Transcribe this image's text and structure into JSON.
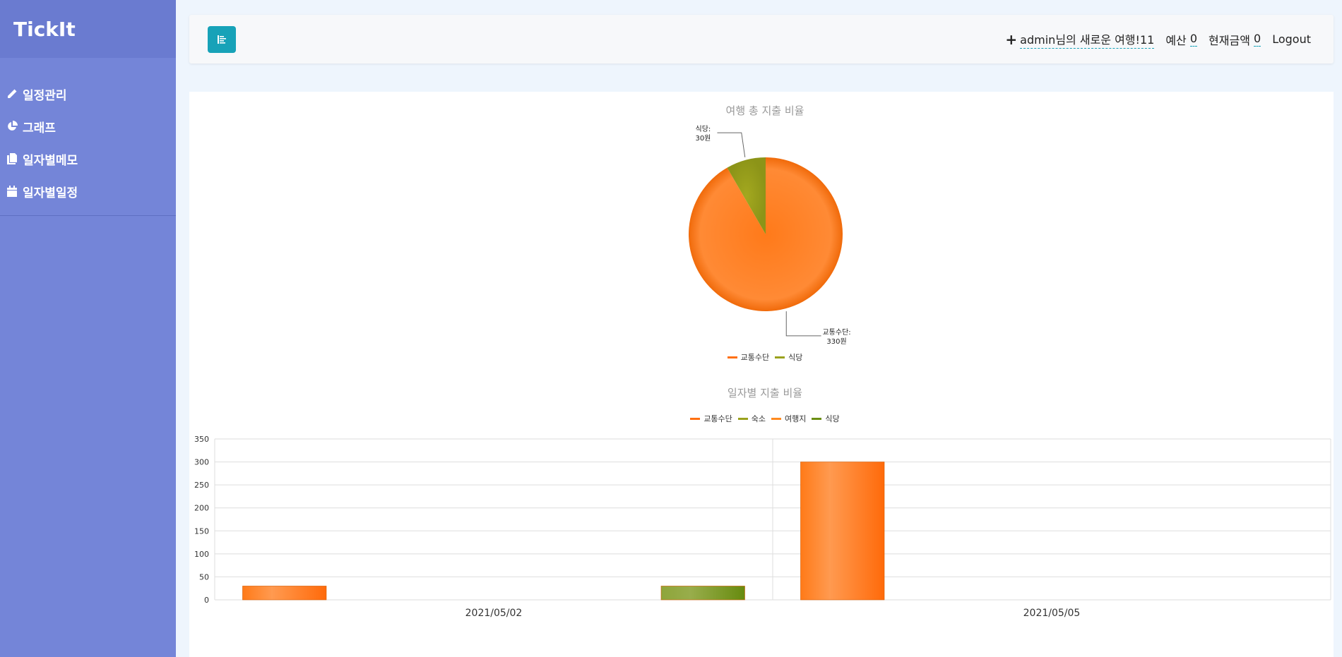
{
  "app": {
    "brand": "TickIt"
  },
  "sidebar": {
    "items": [
      {
        "label": "일정관리",
        "icon": "pencil-icon"
      },
      {
        "label": "그래프",
        "icon": "pie-chart-icon"
      },
      {
        "label": "일자별메모",
        "icon": "copy-icon"
      },
      {
        "label": "일자별일정",
        "icon": "calendar-icon"
      }
    ]
  },
  "topbar": {
    "trip_owner": "admin",
    "trip_suffix": "님의 새로운 여행!11",
    "budget_label": "예산",
    "budget_value": "0",
    "current_label": "현재금액",
    "current_value": "0",
    "logout_label": "Logout"
  },
  "colors": {
    "accent": "#17a2b8",
    "sidebar": "#7485d8",
    "transport": "#ff7011",
    "lodging": "#9aa11c",
    "destination": "#ff8a1f",
    "restaurant": "#6b8e12"
  },
  "chart_data": [
    {
      "type": "pie",
      "title": "여행 총 지출 비율",
      "legend_position": "bottom",
      "slices": [
        {
          "label": "교통수단",
          "value": 330,
          "data_label_name": "교통수단:",
          "data_label_value": "330원",
          "color": "#ff7011"
        },
        {
          "label": "식당",
          "value": 30,
          "data_label_name": "식당:",
          "data_label_value": "30원",
          "color": "#9aa11c"
        }
      ]
    },
    {
      "type": "bar",
      "title": "일자별 지출 비율",
      "legend_position": "top",
      "categories": [
        "2021/05/02",
        "2021/05/05"
      ],
      "ylim": [
        0,
        350
      ],
      "yticks": [
        "0",
        "50",
        "100",
        "150",
        "200",
        "250",
        "300",
        "350"
      ],
      "grid": true,
      "series": [
        {
          "name": "교통수단",
          "color": "#ff7011",
          "values": [
            30,
            300
          ]
        },
        {
          "name": "숙소",
          "color": "#9aa11c",
          "values": [
            0,
            0
          ]
        },
        {
          "name": "여행지",
          "color": "#ff8a1f",
          "values": [
            0,
            0
          ]
        },
        {
          "name": "식당",
          "color": "#6b8e12",
          "values": [
            30,
            0
          ]
        }
      ]
    }
  ]
}
